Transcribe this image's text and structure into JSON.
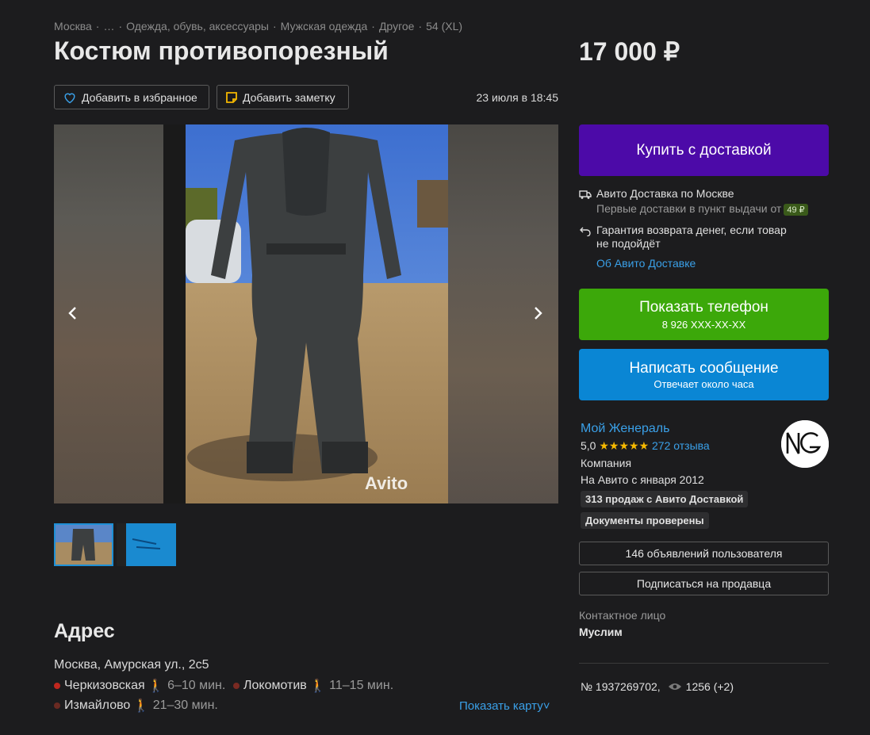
{
  "breadcrumbs": [
    "Москва",
    "…",
    "Одежда, обувь, аксессуары",
    "Мужская одежда",
    "Другое",
    "54 (XL)"
  ],
  "title": "Костюм противопорезный",
  "price": "17 000 ₽",
  "actions": {
    "favorite": "Добавить в избранное",
    "note": "Добавить заметку"
  },
  "date": "23 июля в 18:45",
  "gallery": {
    "watermark": "Avito",
    "thumbnails": 2
  },
  "address": {
    "heading": "Адрес",
    "text": "Москва, Амурская ул., 2с5",
    "metro": [
      {
        "name": "Черкизовская",
        "time": "6–10 мин.",
        "color": "#c0271e"
      },
      {
        "name": "Локомотив",
        "time": "11–15 мин.",
        "color": "#7a2a22"
      },
      {
        "name": "Измайлово",
        "time": "21–30 мин.",
        "color": "#6a2a22"
      }
    ],
    "show_map": "Показать карту"
  },
  "buy": {
    "label": "Купить с доставкой",
    "color": "#4c0aa8"
  },
  "delivery": {
    "title": "Авито Доставка по Москве",
    "subtitle": "Первые доставки в пункт выдачи от",
    "badge": "49 ₽",
    "guarantee_1": "Гарантия возврата денег, если товар",
    "guarantee_2": "не подойдёт",
    "link": "Об Авито Доставке"
  },
  "phone": {
    "label": "Показать телефон",
    "number": "8 926 XXX-XX-XX",
    "color": "#3ca80a"
  },
  "message": {
    "label": "Написать сообщение",
    "sub": "Отвечает около часа",
    "color": "#0a86d4"
  },
  "seller": {
    "name": "Мой Женераль",
    "rating": "5,0",
    "stars": "★★★★★",
    "reviews": "272 отзыва",
    "type": "Компания",
    "since": "На Авито с января 2012",
    "chips": [
      "313 продаж с Авито Доставкой",
      "Документы проверены"
    ]
  },
  "user_ads": "146 объявлений пользователя",
  "subscribe": "Подписаться на продавца",
  "contact": {
    "label": "Контактное лицо",
    "name": "Муслим"
  },
  "meta": {
    "id": "№ 1937269702,",
    "views": "1256 (+2)"
  }
}
